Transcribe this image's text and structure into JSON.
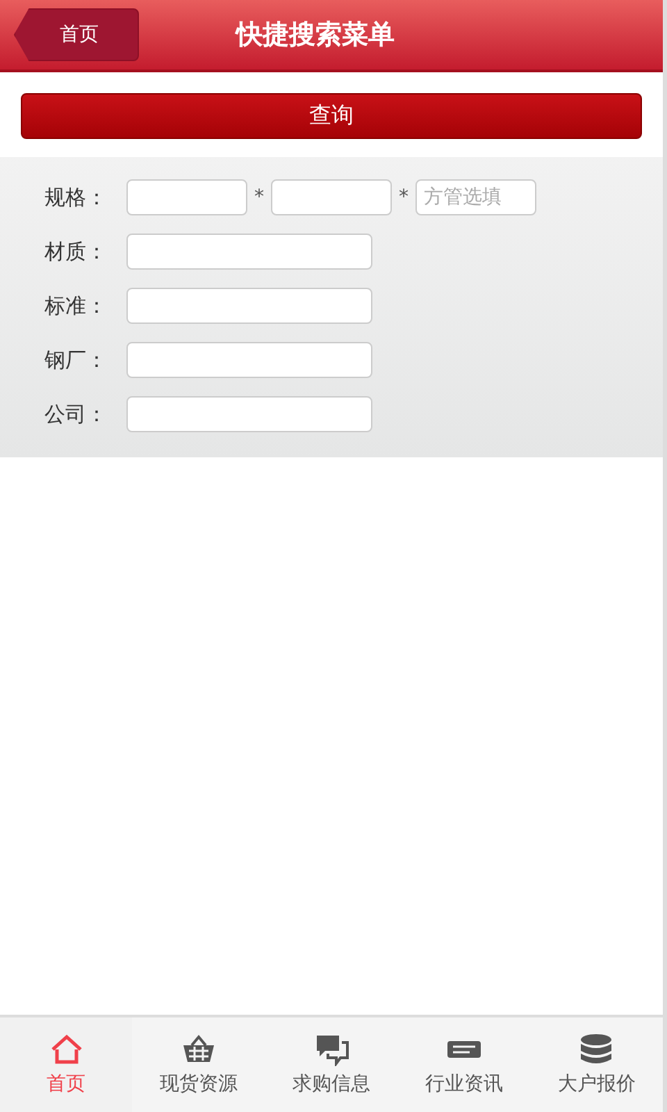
{
  "header": {
    "back_button": "首页",
    "title": "快捷搜索菜单"
  },
  "query_button": "查询",
  "form": {
    "rows": [
      {
        "label": "规格：",
        "parts": [
          {
            "kind": "input"
          },
          {
            "kind": "separator",
            "text": "*"
          },
          {
            "kind": "input"
          },
          {
            "kind": "separator",
            "text": "*"
          },
          {
            "kind": "input",
            "placeholder": "方管选填"
          }
        ]
      },
      {
        "label": "材质：",
        "parts": [
          {
            "kind": "wide_input"
          }
        ]
      },
      {
        "label": "标准：",
        "parts": [
          {
            "kind": "wide_input"
          }
        ]
      },
      {
        "label": "钢厂：",
        "parts": [
          {
            "kind": "wide_input"
          }
        ]
      },
      {
        "label": "公司：",
        "parts": [
          {
            "kind": "wide_input"
          }
        ]
      }
    ]
  },
  "tab_bar": [
    {
      "label": "首页",
      "selected": true
    },
    {
      "label": "现货资源",
      "selected": false
    },
    {
      "label": "求购信息",
      "selected": false
    },
    {
      "label": "行业资讯",
      "selected": false
    },
    {
      "label": "大户报价",
      "selected": false
    }
  ]
}
